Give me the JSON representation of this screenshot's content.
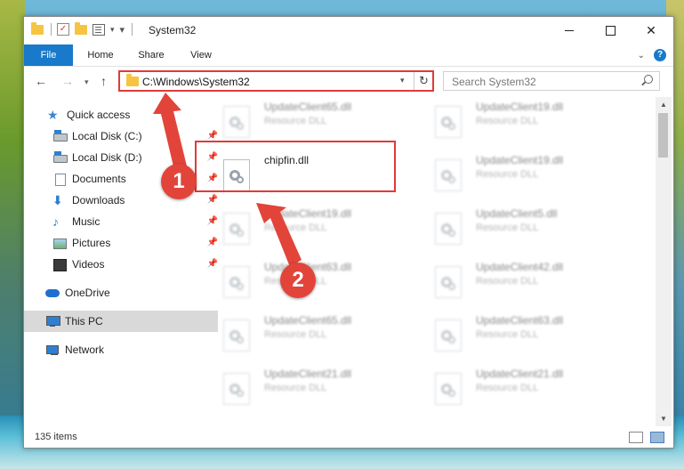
{
  "window": {
    "title": "System32"
  },
  "ribbon": {
    "tabs": [
      "File",
      "Home",
      "Share",
      "View"
    ]
  },
  "address": {
    "path": "C:\\Windows\\System32"
  },
  "search": {
    "placeholder": "Search System32"
  },
  "sidebar": {
    "items": [
      {
        "label": "Quick access",
        "icon": "star-icon"
      },
      {
        "label": "Local Disk (C:)",
        "icon": "drive-icon",
        "pinned": true
      },
      {
        "label": "Local Disk (D:)",
        "icon": "drive-icon",
        "pinned": true
      },
      {
        "label": "Documents",
        "icon": "documents-icon",
        "pinned": true
      },
      {
        "label": "Downloads",
        "icon": "downloads-icon",
        "pinned": true
      },
      {
        "label": "Music",
        "icon": "music-icon",
        "pinned": true
      },
      {
        "label": "Pictures",
        "icon": "pictures-icon",
        "pinned": true
      },
      {
        "label": "Videos",
        "icon": "videos-icon",
        "pinned": true
      },
      {
        "label": "OneDrive",
        "icon": "onedrive-icon"
      },
      {
        "label": "This PC",
        "icon": "pc-icon",
        "selected": true
      },
      {
        "label": "Network",
        "icon": "network-icon"
      }
    ]
  },
  "files": {
    "left": [
      {
        "name": "UpdateClient65.dll",
        "type": "Resource DLL"
      },
      {
        "name": "chipfin.dll",
        "type": ""
      },
      {
        "name": "UpdateClient19.dll",
        "type": "Resource DLL"
      },
      {
        "name": "UpdateClient63.dll",
        "type": "Resource DLL"
      },
      {
        "name": "UpdateClient65.dll",
        "type": "Resource DLL"
      },
      {
        "name": "UpdateClient21.dll",
        "type": "Resource DLL"
      }
    ],
    "right": [
      {
        "name": "UpdateClient19.dll",
        "type": "Resource DLL"
      },
      {
        "name": "UpdateClient19.dll",
        "type": "Resource DLL"
      },
      {
        "name": "UpdateClient5.dll",
        "type": "Resource DLL"
      },
      {
        "name": "UpdateClient42.dll",
        "type": "Resource DLL"
      },
      {
        "name": "UpdateClient63.dll",
        "type": "Resource DLL"
      },
      {
        "name": "UpdateClient21.dll",
        "type": "Resource DLL"
      }
    ]
  },
  "status": {
    "item_count": "135 items"
  },
  "annotations": {
    "step1": "1",
    "step2": "2"
  },
  "colors": {
    "accent": "#1979ca",
    "annotation": "#e2443a"
  }
}
